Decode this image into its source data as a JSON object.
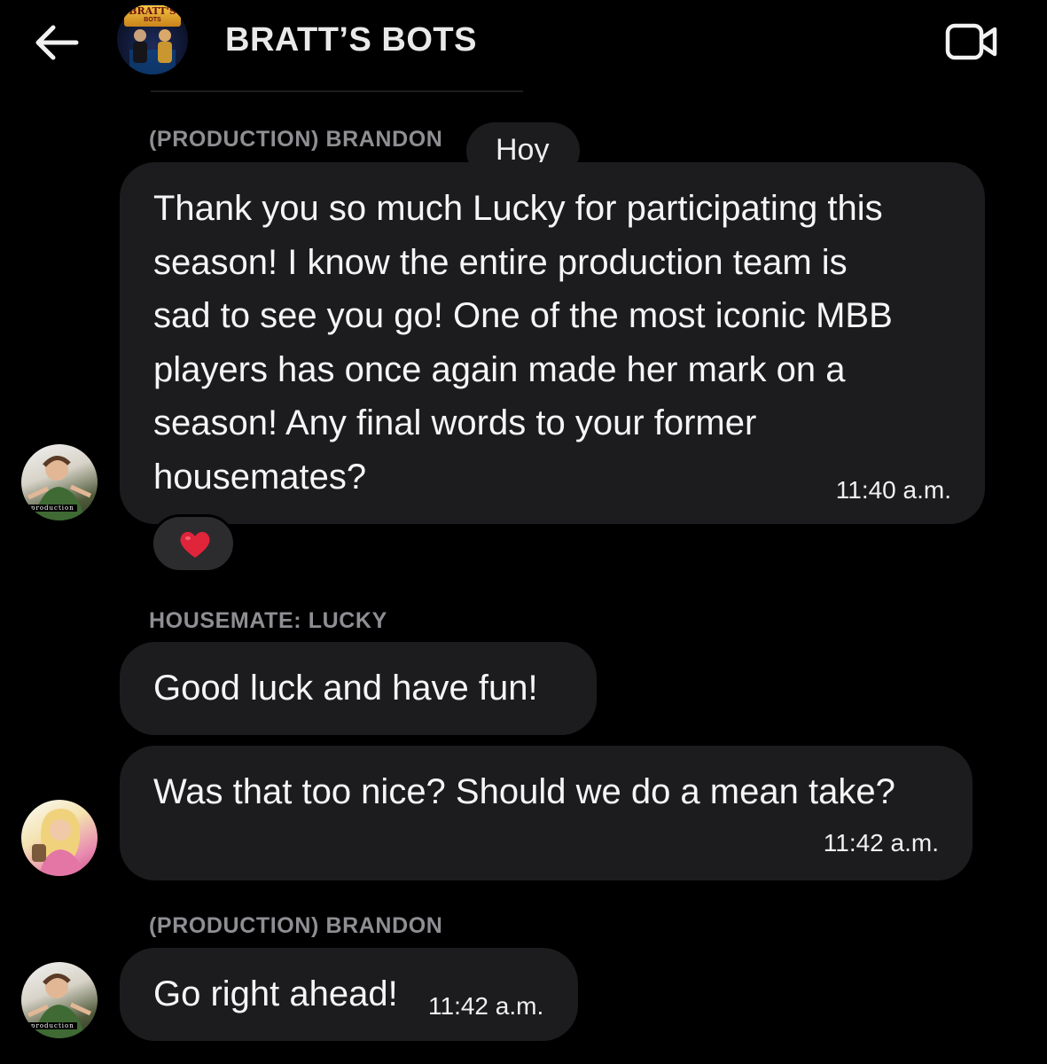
{
  "header": {
    "title": "BRATT’S BOTS",
    "avatar_logo_main": "BRATT'S",
    "avatar_logo_sub": "BOTS"
  },
  "messages": [
    {
      "sender": "(PRODUCTION) BRANDON",
      "reply_preview": "Hoy",
      "lines": [
        "Thank you so much Lucky for participating this",
        "season! I know the entire production team is",
        "sad to see you go! One of the most iconic MBB",
        "players has once again made her mark on a",
        "season! Any final words to your former",
        "housemates?"
      ],
      "time": "11:40 a.m.",
      "reaction": "heart",
      "avatar_label": "production"
    },
    {
      "sender": "HOUSEMATE: LUCKY",
      "bubbles": [
        {
          "text": "Good luck and have fun!"
        },
        {
          "text": "Was that too nice? Should we do a mean take?",
          "time": "11:42 a.m."
        }
      ]
    },
    {
      "sender": "(PRODUCTION) BRANDON",
      "text": "Go right ahead!",
      "time": "11:42 a.m.",
      "avatar_label": "production"
    }
  ],
  "colors": {
    "background": "#000000",
    "bubble": "#1c1c1e",
    "sender_label": "#8e8e93",
    "reaction_heart": "#e0243a"
  }
}
